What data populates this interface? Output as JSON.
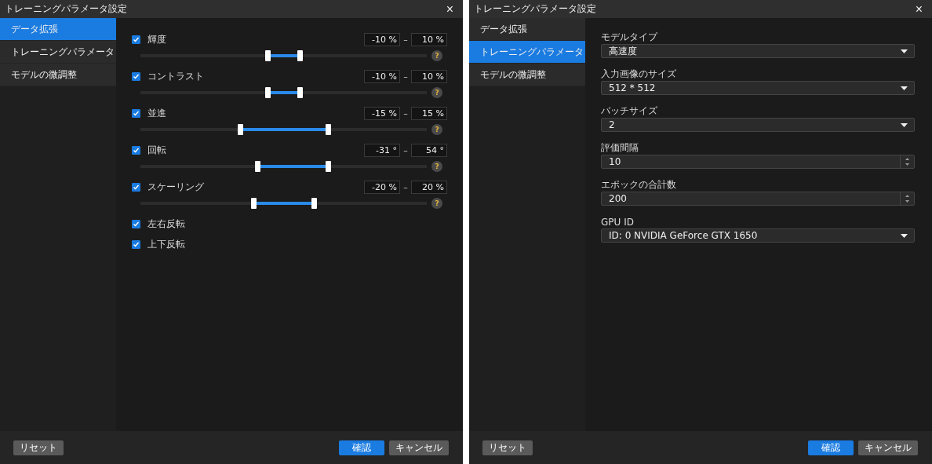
{
  "dialogs": [
    {
      "title": "トレーニングパラメータ設定",
      "close": "×",
      "nav": [
        {
          "label": "データ拡張",
          "selected": true
        },
        {
          "label": "トレーニングパラメータ",
          "selected": false
        },
        {
          "label": "モデルの微調整",
          "selected": false
        }
      ],
      "content": {
        "kind": "augmentation",
        "ranges": [
          {
            "label": "輝度",
            "checked": true,
            "min": "-10 %",
            "max": "10 %",
            "sep": "–",
            "help": "?",
            "thumbs": [
              {
                "level": 0.444
              },
              {
                "level": 0.556
              }
            ]
          },
          {
            "label": "コントラスト",
            "checked": true,
            "min": "-10 %",
            "max": "10 %",
            "sep": "–",
            "help": "?",
            "thumbs": [
              {
                "level": 0.444
              },
              {
                "level": 0.556
              }
            ]
          },
          {
            "label": "並進",
            "checked": true,
            "min": "-15 %",
            "max": "15 %",
            "sep": "–",
            "help": "?",
            "thumbs": [
              {
                "level": 0.348
              },
              {
                "level": 0.655
              }
            ]
          },
          {
            "label": "回転",
            "checked": true,
            "min": "-31 °",
            "max": "54 °",
            "sep": "–",
            "help": "?",
            "thumbs": [
              {
                "level": 0.408
              },
              {
                "level": 0.655
              }
            ]
          },
          {
            "label": "スケーリング",
            "checked": true,
            "min": "-20 %",
            "max": "20 %",
            "sep": "–",
            "help": "?",
            "thumbs": [
              {
                "level": 0.395
              },
              {
                "level": 0.605
              }
            ]
          }
        ],
        "flips": [
          {
            "label": "左右反転",
            "checked": true
          },
          {
            "label": "上下反転",
            "checked": true
          }
        ]
      },
      "footer": {
        "reset": "リセット",
        "ok": "確認",
        "cancel": "キャンセル"
      }
    },
    {
      "title": "トレーニングパラメータ設定",
      "close": "×",
      "nav": [
        {
          "label": "データ拡張",
          "selected": false
        },
        {
          "label": "トレーニングパラメータ",
          "selected": true
        },
        {
          "label": "モデルの微調整",
          "selected": false
        }
      ],
      "content": {
        "kind": "training",
        "fields": [
          {
            "kind": "select",
            "label": "モデルタイプ",
            "value": "高速度"
          },
          {
            "kind": "select",
            "label": "入力画像のサイズ",
            "value": "512 * 512"
          },
          {
            "kind": "select",
            "label": "バッチサイズ",
            "value": "2"
          },
          {
            "kind": "spin",
            "label": "評価間隔",
            "value": "10"
          },
          {
            "kind": "spin",
            "label": "エポックの合計数",
            "value": "200"
          },
          {
            "kind": "select",
            "label": "GPU ID",
            "value": "ID: 0  NVIDIA GeForce GTX 1650"
          }
        ]
      },
      "footer": {
        "reset": "リセット",
        "ok": "確認",
        "cancel": "キャンセル"
      }
    }
  ]
}
